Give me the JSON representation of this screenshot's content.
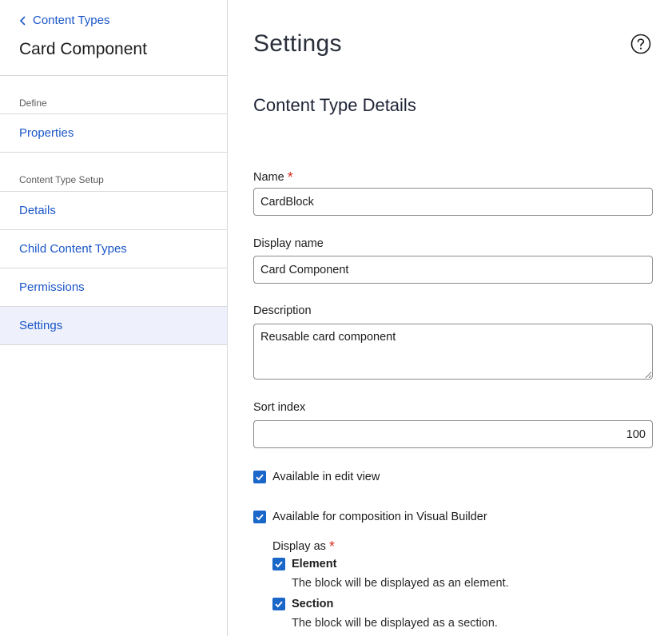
{
  "sidebar": {
    "back_label": "Content Types",
    "title": "Card Component",
    "group_define": "Define",
    "item_properties": "Properties",
    "group_setup": "Content Type Setup",
    "item_details": "Details",
    "item_child_types": "Child Content Types",
    "item_permissions": "Permissions",
    "item_settings": "Settings",
    "active_item": "Settings"
  },
  "main": {
    "title": "Settings",
    "help_icon": "question-circle-icon",
    "section_title": "Content Type Details",
    "name_label": "Name",
    "name_value": "CardBlock",
    "display_name_label": "Display name",
    "display_name_value": "Card Component",
    "description_label": "Description",
    "description_value": "Reusable card component",
    "sort_index_label": "Sort index",
    "sort_index_value": "100",
    "available_edit_label": "Available in edit view",
    "available_edit_checked": true,
    "available_composition_label": "Available for composition in Visual Builder",
    "available_composition_checked": true,
    "display_as_label": "Display as",
    "element_label": "Element",
    "element_checked": true,
    "element_hint": "The block will be displayed as an element.",
    "section_label": "Section",
    "section_checked": true,
    "section_hint": "The block will be displayed as a section."
  },
  "colors": {
    "link": "#1a56c8",
    "checkbox": "#1a66c9",
    "active_bg": "#eef0fb",
    "required": "#d93025"
  }
}
